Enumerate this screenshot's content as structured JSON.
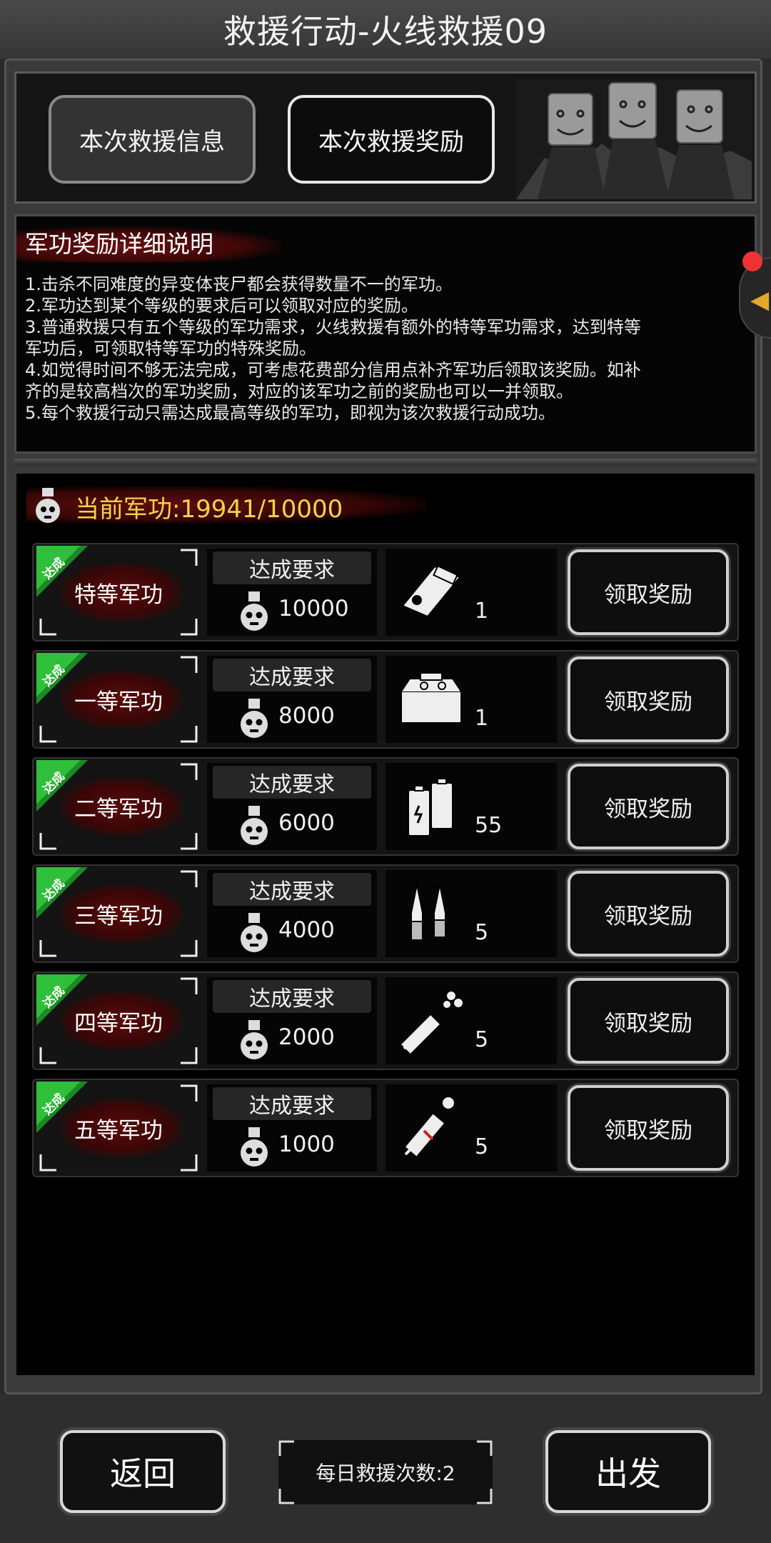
{
  "title": "救援行动-火线救援09",
  "tabs": {
    "info": "本次救援信息",
    "reward": "本次救援奖励"
  },
  "explain": {
    "title": "军功奖励详细说明",
    "lines": [
      "1.击杀不同难度的异变体丧尸都会获得数量不一的军功。",
      "2.军功达到某个等级的要求后可以领取对应的奖励。",
      "3.普通救援只有五个等级的军功需求，火线救援有额外的特等军功需求，达到特等",
      "军功后，可领取特等军功的特殊奖励。",
      "4.如觉得时间不够无法完成，可考虑花费部分信用点补齐军功后领取该奖励。如补",
      "齐的是较高档次的军功奖励，对应的该军功之前的奖励也可以一并领取。",
      "5.每个救援行动只需达成最高等级的军功，即视为该次救援行动成功。"
    ]
  },
  "merit_current": "当前军功:19941/10000",
  "rows": [
    {
      "badge": "达成",
      "rank": "特等军功",
      "req_label": "达成要求",
      "req_value": "10000",
      "item_icon": "bullet-clip-icon",
      "count": "1",
      "button": "领取奖励"
    },
    {
      "badge": "达成",
      "rank": "一等军功",
      "req_label": "达成要求",
      "req_value": "8000",
      "item_icon": "toolbox-icon",
      "count": "1",
      "button": "领取奖励"
    },
    {
      "badge": "达成",
      "rank": "二等军功",
      "req_label": "达成要求",
      "req_value": "6000",
      "item_icon": "battery-icon",
      "count": "55",
      "button": "领取奖励"
    },
    {
      "badge": "达成",
      "rank": "三等军功",
      "req_label": "达成要求",
      "req_value": "4000",
      "item_icon": "ampoule-icon",
      "count": "5",
      "button": "领取奖励"
    },
    {
      "badge": "达成",
      "rank": "四等军功",
      "req_label": "达成要求",
      "req_value": "2000",
      "item_icon": "syringe-icon",
      "count": "5",
      "button": "领取奖励"
    },
    {
      "badge": "达成",
      "rank": "五等军功",
      "req_label": "达成要求",
      "req_value": "1000",
      "item_icon": "injector-icon",
      "count": "5",
      "button": "领取奖励"
    }
  ],
  "footer": {
    "back": "返回",
    "daily": "每日救援次数:2",
    "go": "出发"
  },
  "colors": {
    "merit_text": "#f2d44a",
    "badge_green": "#2fbf3a",
    "side_arrow": "#e6a82b"
  }
}
